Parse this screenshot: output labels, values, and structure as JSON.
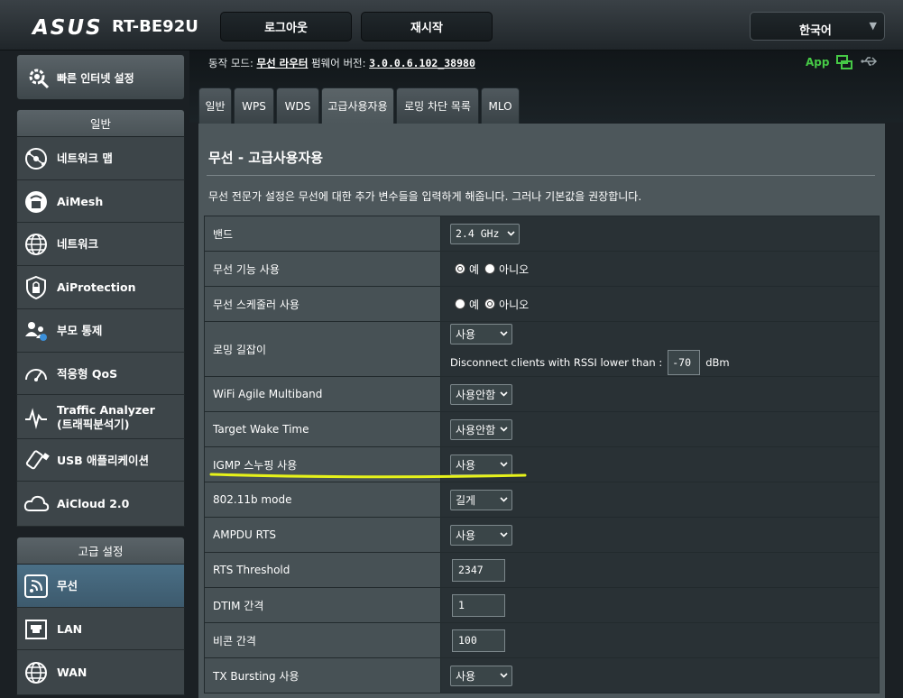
{
  "header": {
    "brand": "ASUS",
    "model": "RT-BE92U",
    "logout_label": "로그아웃",
    "reboot_label": "재시작",
    "language": "한국어"
  },
  "status": {
    "op_mode_label": "동작 모드:",
    "op_mode_value": "무선 라우터",
    "firmware_label": "펌웨어 버전:",
    "firmware_value": "3.0.0.6.102_38980",
    "app_label": "App"
  },
  "sidebar": {
    "quick_setup": "빠른 인터넷 설정",
    "general_head": "일반",
    "general_items": [
      {
        "label": "네트워크 맵",
        "icon": "network-map-icon"
      },
      {
        "label": "AiMesh",
        "icon": "aimesh-icon"
      },
      {
        "label": "네트워크",
        "icon": "network-globe-icon"
      },
      {
        "label": "AiProtection",
        "icon": "shield-lock-icon"
      },
      {
        "label": "부모 통제",
        "icon": "parental-control-icon"
      },
      {
        "label": "적응형 QoS",
        "icon": "speedometer-icon"
      },
      {
        "label": "Traffic Analyzer",
        "label2": "(트래픽분석기)",
        "icon": "traffic-analyzer-icon"
      },
      {
        "label": "USB 애플리케이션",
        "icon": "usb-stick-icon"
      },
      {
        "label": "AiCloud 2.0",
        "icon": "cloud-icon"
      }
    ],
    "advanced_head": "고급 설정",
    "advanced_items": [
      {
        "label": "무선",
        "icon": "wifi-icon",
        "active": true
      },
      {
        "label": "LAN",
        "icon": "lan-port-icon"
      },
      {
        "label": "WAN",
        "icon": "wan-globe-icon"
      }
    ]
  },
  "tabs": [
    {
      "label": "일반"
    },
    {
      "label": "WPS"
    },
    {
      "label": "WDS"
    },
    {
      "label": "고급사용자용",
      "active": true
    },
    {
      "label": "로밍 차단 목록"
    },
    {
      "label": "MLO"
    }
  ],
  "panel": {
    "title": "무선 - 고급사용자용",
    "description": "무선 전문가 설정은 무선에 대한 추가 변수들을 입력하게 해줍니다. 그러나 기본값을 권장합니다."
  },
  "settings": {
    "band": {
      "label": "밴드",
      "value": "2.4 GHz"
    },
    "radio_enable": {
      "label": "무선 기능 사용",
      "yes": "예",
      "no": "아니오",
      "selected": "yes"
    },
    "scheduler": {
      "label": "무선 스케줄러 사용",
      "yes": "예",
      "no": "아니오",
      "selected": "no"
    },
    "roaming": {
      "label": "로밍 길잡이",
      "value": "사용",
      "rssi_text": "Disconnect clients with RSSI lower than :",
      "rssi_value": "-70",
      "rssi_unit": "dBm"
    },
    "agile_multiband": {
      "label": "WiFi Agile Multiband",
      "value": "사용안함"
    },
    "twt": {
      "label": "Target Wake Time",
      "value": "사용안함"
    },
    "igmp": {
      "label": "IGMP 스누핑 사용",
      "value": "사용"
    },
    "mode_11b": {
      "label": "802.11b mode",
      "value": "길게"
    },
    "ampdu_rts": {
      "label": "AMPDU RTS",
      "value": "사용"
    },
    "rts_threshold": {
      "label": "RTS Threshold",
      "value": "2347"
    },
    "dtim": {
      "label": "DTIM 간격",
      "value": "1"
    },
    "beacon": {
      "label": "비콘 간격",
      "value": "100"
    },
    "tx_bursting": {
      "label": "TX Bursting 사용",
      "value": "사용"
    }
  },
  "colors": {
    "highlight": "#e6f21a",
    "app_green": "#46c946",
    "active_menu": "#4a6f86"
  }
}
